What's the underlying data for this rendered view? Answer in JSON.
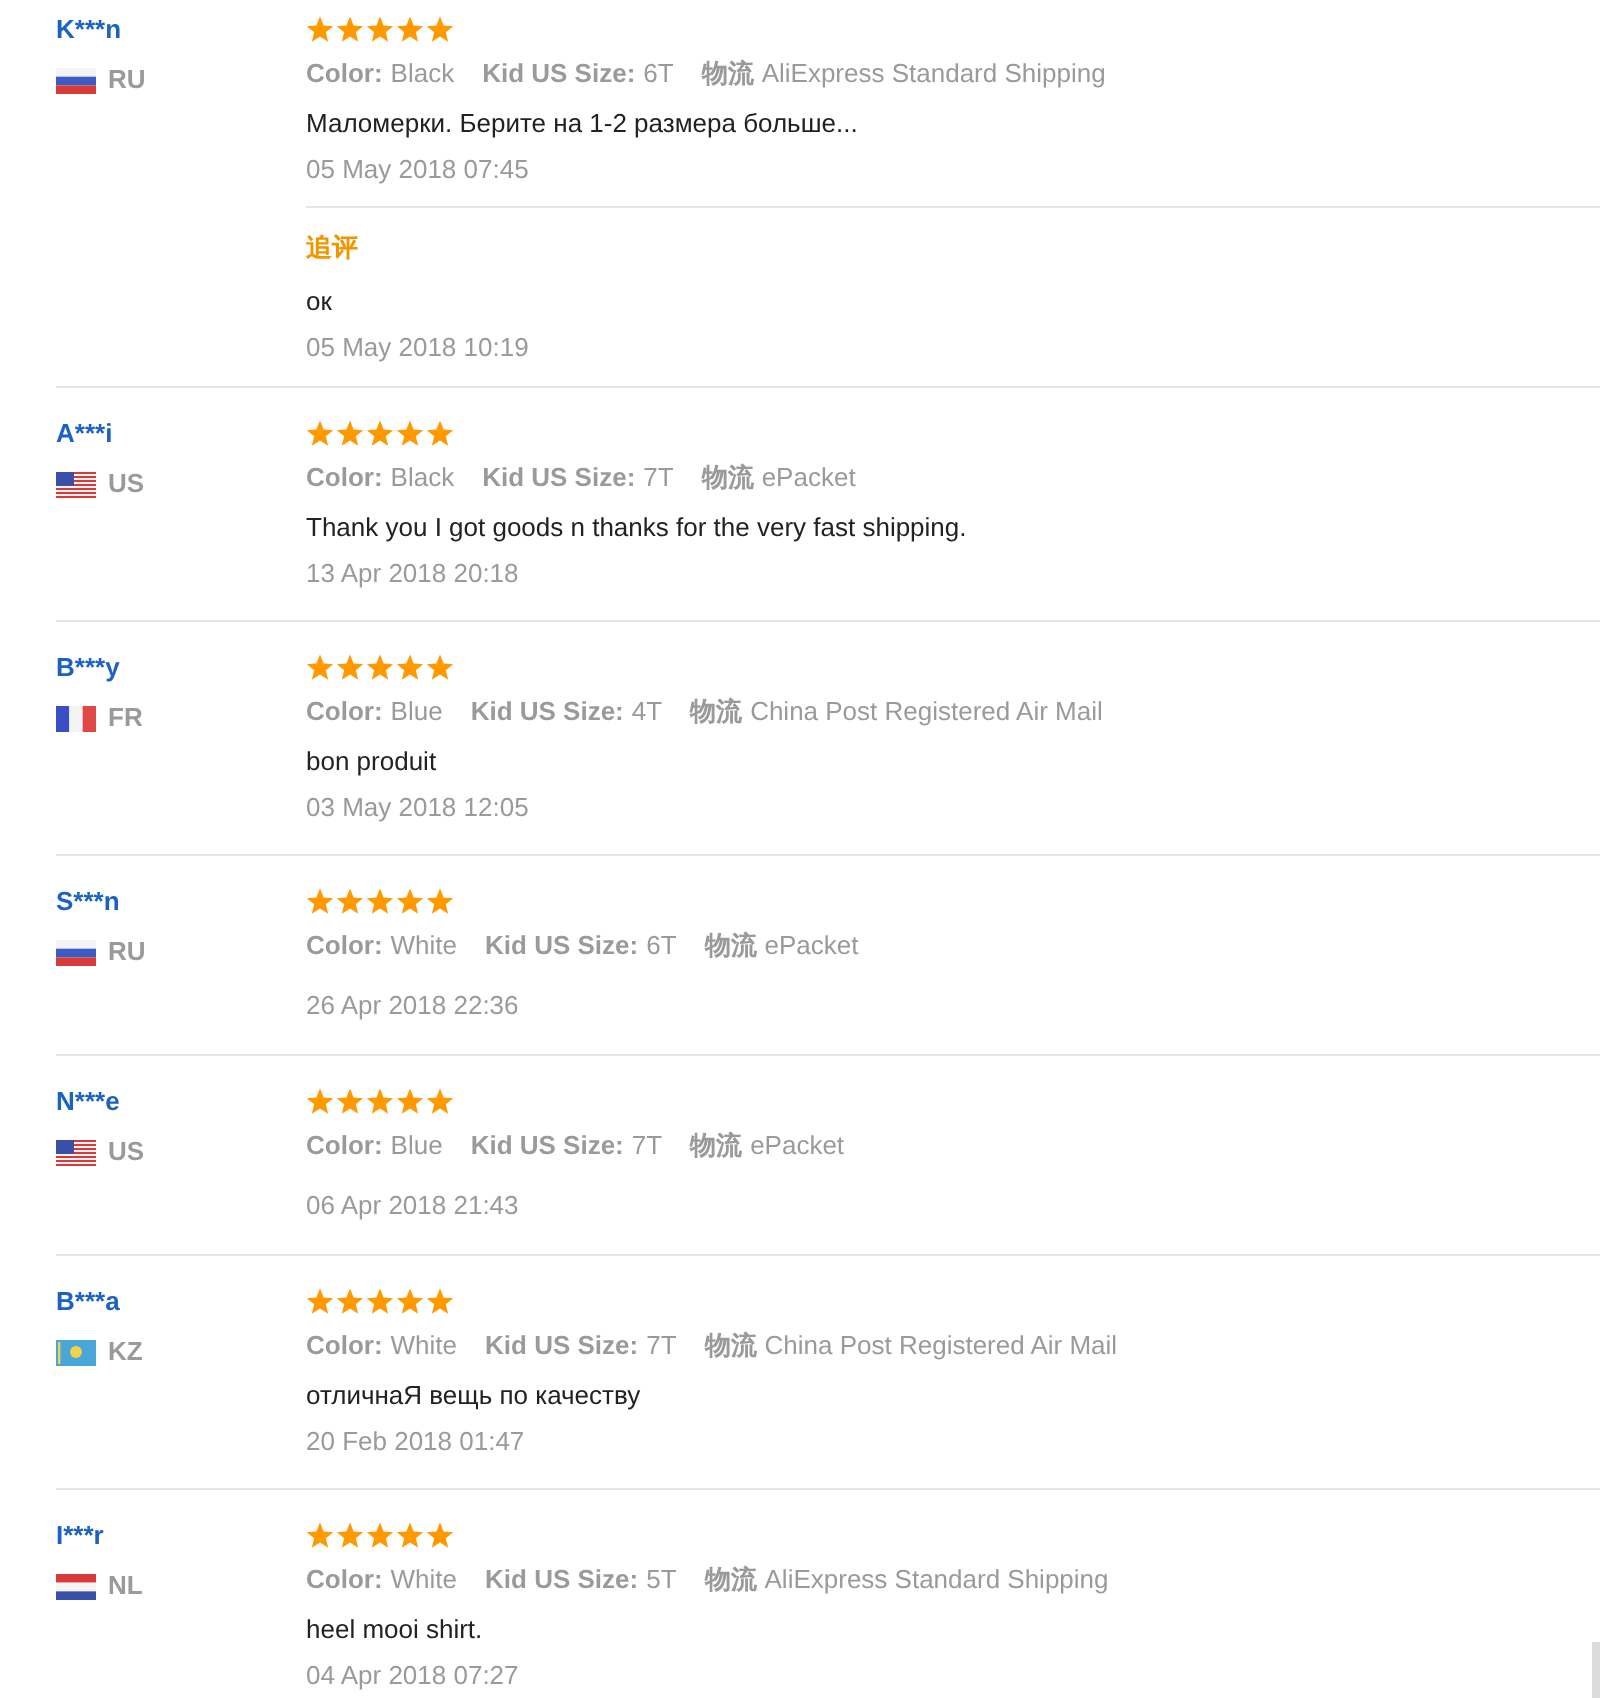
{
  "reviews": [
    {
      "name": "K***n",
      "flag": {
        "kind": "russia"
      },
      "country": "RU",
      "stars": 5,
      "attributes": [
        {
          "label": "Color:",
          "value": "Black"
        },
        {
          "label": "Kid US Size:",
          "value": "6T"
        },
        {
          "label": "物流",
          "value": "AliExpress Standard Shipping"
        }
      ],
      "text": "Маломерки. Берите на 1-2 размера больше...",
      "date": "05 May 2018 07:45",
      "follow_up": {
        "label": "追评",
        "text": "ок",
        "date": "05 May 2018 10:19"
      }
    },
    {
      "name": "A***i",
      "flag": {
        "kind": "usa"
      },
      "country": "US",
      "stars": 5,
      "attributes": [
        {
          "label": "Color:",
          "value": "Black"
        },
        {
          "label": "Kid US Size:",
          "value": "7T"
        },
        {
          "label": "物流",
          "value": "ePacket"
        }
      ],
      "text": "Thank you I got goods n thanks for the very fast shipping.",
      "date": "13 Apr 2018 20:18"
    },
    {
      "name": "B***y",
      "flag": {
        "kind": "france"
      },
      "country": "FR",
      "stars": 5,
      "attributes": [
        {
          "label": "Color:",
          "value": "Blue"
        },
        {
          "label": "Kid US Size:",
          "value": "4T"
        },
        {
          "label": "物流",
          "value": "China Post Registered Air Mail"
        }
      ],
      "text": "bon produit",
      "date": "03 May 2018 12:05"
    },
    {
      "name": "S***n",
      "flag": {
        "kind": "russia"
      },
      "country": "RU",
      "stars": 5,
      "attributes": [
        {
          "label": "Color:",
          "value": "White"
        },
        {
          "label": "Kid US Size:",
          "value": "6T"
        },
        {
          "label": "物流",
          "value": "ePacket"
        }
      ],
      "date": "26 Apr 2018 22:36"
    },
    {
      "name": "N***e",
      "flag": {
        "kind": "usa"
      },
      "country": "US",
      "stars": 5,
      "attributes": [
        {
          "label": "Color:",
          "value": "Blue"
        },
        {
          "label": "Kid US Size:",
          "value": "7T"
        },
        {
          "label": "物流",
          "value": "ePacket"
        }
      ],
      "date": "06 Apr 2018 21:43"
    },
    {
      "name": "B***a",
      "flag": {
        "kind": "kazakhstan"
      },
      "country": "KZ",
      "stars": 5,
      "attributes": [
        {
          "label": "Color:",
          "value": "White"
        },
        {
          "label": "Kid US Size:",
          "value": "7T"
        },
        {
          "label": "物流",
          "value": "China Post Registered Air Mail"
        }
      ],
      "text": "отличнаЯ вещь по качеству",
      "date": "20 Feb 2018 01:47"
    },
    {
      "name": "I***r",
      "flag": {
        "kind": "netherlands"
      },
      "country": "NL",
      "stars": 5,
      "attributes": [
        {
          "label": "Color:",
          "value": "White"
        },
        {
          "label": "Kid US Size:",
          "value": "5T"
        },
        {
          "label": "物流",
          "value": "AliExpress Standard Shipping"
        }
      ],
      "text": "heel mooi shirt.",
      "date": "04 Apr 2018 07:27"
    }
  ]
}
